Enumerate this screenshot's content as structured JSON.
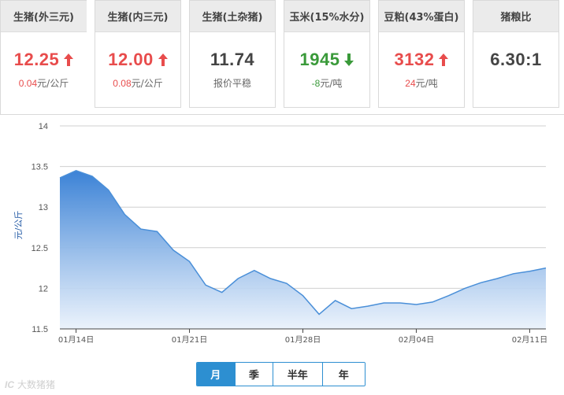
{
  "cards": [
    {
      "title": "生猪(外三元)",
      "value": "12.25",
      "trend": "up",
      "change_num": "0.04",
      "change_unit": "元/公斤",
      "active": true
    },
    {
      "title": "生猪(内三元)",
      "value": "12.00",
      "trend": "up",
      "change_num": "0.08",
      "change_unit": "元/公斤",
      "active": false
    },
    {
      "title": "生猪(土杂猪)",
      "value": "11.74",
      "trend": "flat",
      "change_num": "",
      "change_unit": "报价平稳",
      "active": false
    },
    {
      "title": "玉米(15%水分)",
      "value": "1945",
      "trend": "down",
      "change_num": "-8",
      "change_unit": "元/吨",
      "active": false
    },
    {
      "title": "豆粕(43%蛋白)",
      "value": "3132",
      "trend": "up",
      "change_num": "24",
      "change_unit": "元/吨",
      "active": false
    },
    {
      "title": "猪粮比",
      "value": "6.30:1",
      "trend": "flat",
      "change_num": "",
      "change_unit": "",
      "active": false
    }
  ],
  "colors": {
    "up": "#e84c4c",
    "down": "#3a9a3a",
    "line": "#4a8fd8",
    "tab_active": "#2d8fd1"
  },
  "chart_data": {
    "type": "area",
    "title": "",
    "xlabel": "",
    "ylabel": "元/公斤",
    "ylim": [
      11.5,
      14
    ],
    "yticks": [
      "11.5",
      "12",
      "12.5",
      "13",
      "13.5",
      "14"
    ],
    "xtick_labels": [
      "01月14日",
      "01月21日",
      "01月28日",
      "02月04日",
      "02月11日"
    ],
    "grid": true,
    "legend": "none",
    "x": [
      "01-13",
      "01-14",
      "01-15",
      "01-16",
      "01-17",
      "01-18",
      "01-19",
      "01-20",
      "01-21",
      "01-22",
      "01-23",
      "01-24",
      "01-25",
      "01-26",
      "01-27",
      "01-28",
      "01-29",
      "01-30",
      "01-31",
      "02-01",
      "02-02",
      "02-03",
      "02-04",
      "02-05",
      "02-06",
      "02-07",
      "02-08",
      "02-09",
      "02-10",
      "02-11",
      "02-12"
    ],
    "series": [
      {
        "values": [
          13.36,
          13.45,
          13.38,
          13.21,
          12.91,
          12.73,
          12.7,
          12.47,
          12.33,
          12.04,
          11.95,
          12.12,
          12.22,
          12.12,
          12.06,
          11.91,
          11.68,
          11.85,
          11.75,
          11.78,
          11.82,
          11.82,
          11.8,
          11.83,
          11.91,
          12.0,
          12.07,
          12.12,
          12.18,
          12.21,
          12.25
        ]
      }
    ]
  },
  "tabs": [
    {
      "label": "月",
      "active": true
    },
    {
      "label": "季",
      "active": false
    },
    {
      "label": "半年",
      "active": false
    },
    {
      "label": "年",
      "active": false
    }
  ],
  "watermark": {
    "logo": "IC",
    "text": "大数猪猪"
  }
}
